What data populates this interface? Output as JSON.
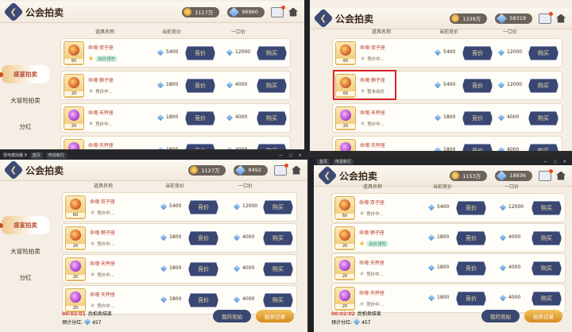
{
  "panels": [
    {
      "title": "公会拍卖",
      "gold": "1117万",
      "gems": "96960",
      "emu_header": null,
      "nav": [
        "盛宴拍卖",
        "大冒险拍卖",
        "分红"
      ],
      "columns": [
        "道具名称",
        "当前竞价",
        "一口价"
      ],
      "rows": [
        {
          "name": "命魂·双子座",
          "qty": "60",
          "status": "出价领先",
          "status_type": "leading",
          "bid": "5400",
          "buyout": "12000"
        },
        {
          "name": "命魂·狮子座",
          "qty": "20",
          "status": "竞价中...",
          "status_type": "bidding",
          "bid": "1800",
          "buyout": "4000"
        },
        {
          "name": "命魂·天秤座",
          "qty": "20",
          "status": "竞价中...",
          "status_type": "bidding",
          "bid": "1800",
          "buyout": "4000"
        },
        {
          "name": "命魂·天秤座",
          "qty": "20",
          "status": "",
          "status_type": "bidding",
          "bid": "1800",
          "buyout": "4000"
        }
      ],
      "footer": null
    },
    {
      "title": "公会拍卖",
      "gold": "1339万",
      "gems": "58319",
      "emu_header": null,
      "nav": [],
      "columns": [
        "道具名称",
        "当前竞价",
        "一口价"
      ],
      "rows": [
        {
          "name": "命魂·双子座",
          "qty": "60",
          "status": "竞价中...",
          "status_type": "bidding",
          "bid": "5400",
          "buyout": "12000"
        },
        {
          "name": "命魂·狮子座",
          "qty": "60",
          "status": "暂未出价",
          "status_type": "none",
          "bid": "5400",
          "buyout": "12000"
        },
        {
          "name": "命魂·天秤座",
          "qty": "20",
          "status": "竞价中...",
          "status_type": "bidding",
          "bid": "1800",
          "buyout": "4000"
        },
        {
          "name": "命魂·天秤座",
          "qty": "20",
          "status": "",
          "status_type": "bidding",
          "bid": "1800",
          "buyout": "4000"
        }
      ],
      "footer": null
    },
    {
      "title": "公会拍卖",
      "gold": "1127万",
      "gems": "8492",
      "emu_header": {
        "app": "雷电模拟器 9",
        "tab1": "首页",
        "tab2": "传说新行"
      },
      "nav": [
        "盛宴拍卖",
        "大冒险拍卖",
        "分红"
      ],
      "columns": [
        "道具名称",
        "当前竞价",
        "一口价"
      ],
      "rows": [
        {
          "name": "命魂·双子座",
          "qty": "60",
          "status": "竞价中...",
          "status_type": "bidding",
          "bid": "5400",
          "buyout": "12000"
        },
        {
          "name": "命魂·狮子座",
          "qty": "20",
          "status": "竞价中...",
          "status_type": "bidding",
          "bid": "1800",
          "buyout": "4000"
        },
        {
          "name": "命魂·天秤座",
          "qty": "20",
          "status": "竞价中...",
          "status_type": "bidding",
          "bid": "1800",
          "buyout": "4000"
        },
        {
          "name": "命魂·天秤座",
          "qty": "20",
          "status": "竞价中...",
          "status_type": "bidding",
          "bid": "1800",
          "buyout": "4000"
        }
      ],
      "footer": {
        "timer": "00:02:01",
        "timer_label": "后拍卖结束",
        "share_label": "预计分红:",
        "share_value": "457",
        "my_bids": "我的竞拍",
        "records": "拍卖记录"
      }
    },
    {
      "title": "公会拍卖",
      "gold": "1153万",
      "gems": "18836",
      "emu_header": {
        "app": "",
        "tab1": "首页",
        "tab2": "传说新行"
      },
      "nav": [],
      "columns": [
        "道具名称",
        "当前竞价",
        "一口价"
      ],
      "rows": [
        {
          "name": "命魂·双子座",
          "qty": "60",
          "status": "竞价中...",
          "status_type": "bidding",
          "bid": "5400",
          "buyout": "12000"
        },
        {
          "name": "命魂·狮子座",
          "qty": "20",
          "status": "出价领先",
          "status_type": "leading",
          "bid": "1800",
          "buyout": "4000"
        },
        {
          "name": "命魂·天秤座",
          "qty": "20",
          "status": "竞价中...",
          "status_type": "bidding",
          "bid": "1800",
          "buyout": "4000"
        },
        {
          "name": "命魂·天秤座",
          "qty": "20",
          "status": "竞价中...",
          "status_type": "bidding",
          "bid": "1800",
          "buyout": "4000"
        }
      ],
      "footer": {
        "timer": "00:02:02",
        "timer_label": "后拍卖结束",
        "share_label": "预计分红:",
        "share_value": "457",
        "my_bids": "我的竞拍",
        "records": "拍卖记录"
      }
    }
  ],
  "labels": {
    "bid_button": "竞价",
    "buy_button": "购买"
  },
  "icons": [
    "back-icon",
    "gold-coin-icon",
    "gem-icon",
    "mail-icon",
    "home-icon",
    "star-icon"
  ],
  "colors": {
    "accent_navy": "#3a4772",
    "highlight_red": "#d9242a",
    "leading_green": "#2d8a5c"
  }
}
